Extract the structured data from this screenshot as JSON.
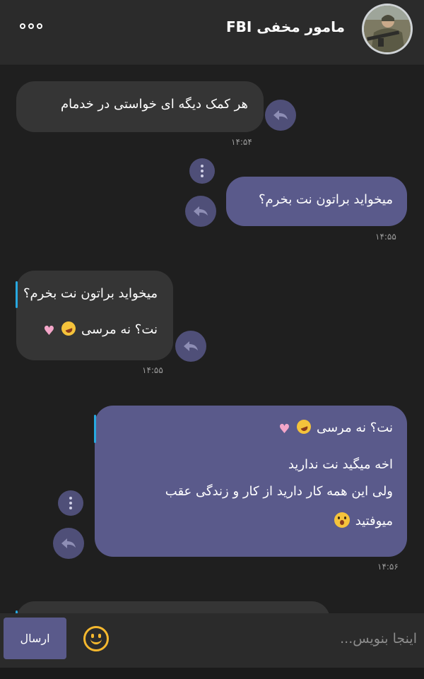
{
  "header": {
    "title": "مامور مخفی FBI",
    "menu_icon": "more-horizontal-icon",
    "avatar": "contact-avatar"
  },
  "messages": [
    {
      "direction": "incoming",
      "lines": [
        "هر کمک دیگه ای خواستی در خدمام"
      ],
      "time": "۱۴:۵۴"
    },
    {
      "direction": "outgoing",
      "lines": [
        "میخواید براتون نت بخرم؟"
      ],
      "time": "۱۴:۵۵"
    },
    {
      "direction": "incoming",
      "quote": "میخواید براتون نت بخرم؟",
      "lines": [
        "نت؟ نه مرسی"
      ],
      "time": "۱۴:۵۵"
    },
    {
      "direction": "outgoing",
      "quote": "نت؟ نه مرسی",
      "lines": [
        "اخه میگید نت ندارید",
        "ولی این همه کار دارید از کار و زندگی عقب",
        "میوفتید"
      ],
      "time": "۱۴:۵۶"
    }
  ],
  "composer": {
    "placeholder": "اینجا بنویس...",
    "send_label": "ارسال",
    "emoji_icon": "smiley-icon"
  },
  "colors": {
    "incoming_bubble": "#353535",
    "outgoing_bubble": "#5a5a8b",
    "quote_accent": "#27a8e0",
    "background": "#1f1f1f"
  }
}
